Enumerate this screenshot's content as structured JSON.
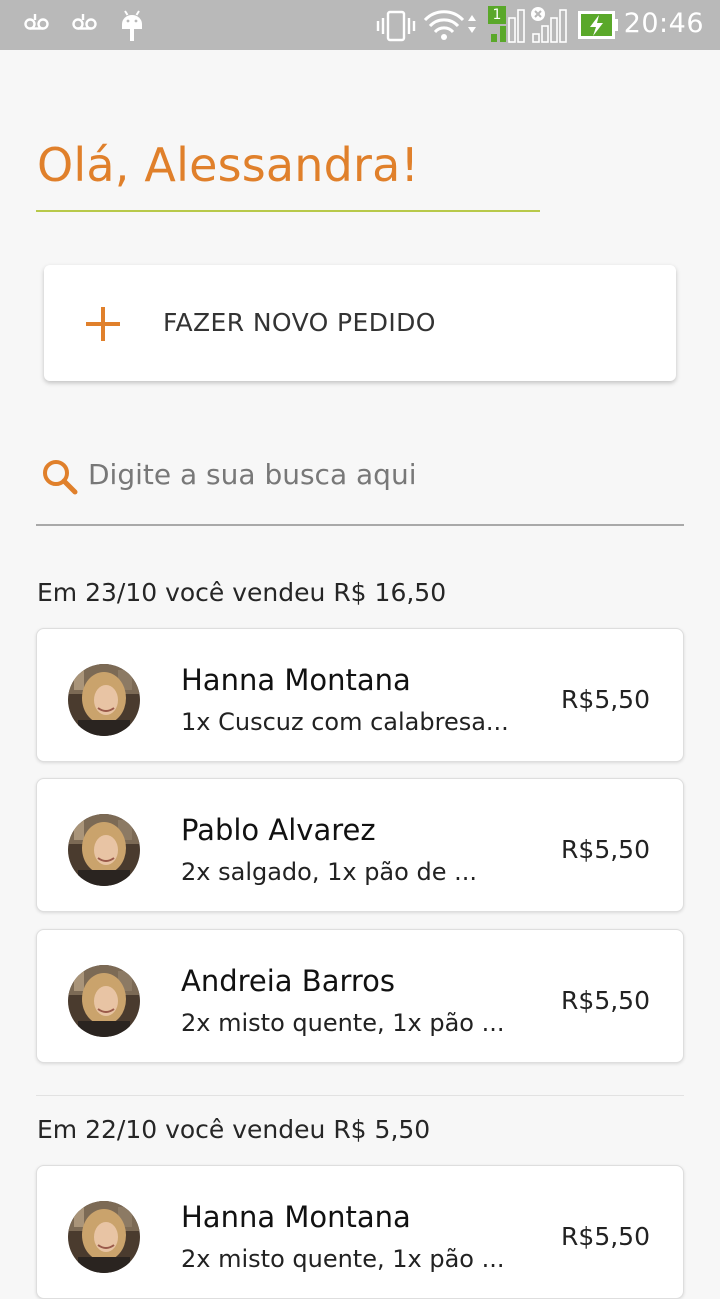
{
  "status_bar": {
    "time": "20:46",
    "icons": [
      "voicemail-icon",
      "voicemail-icon",
      "android-icon",
      "vibrate-icon",
      "wifi-icon",
      "signal-sim1-icon",
      "signal-no-service-icon",
      "battery-charging-icon"
    ],
    "sim_badge": "1"
  },
  "greeting": "Olá, Alessandra!",
  "new_order": {
    "icon": "plus-icon",
    "label": "FAZER NOVO PEDIDO"
  },
  "search": {
    "icon": "search-icon",
    "placeholder": "Digite a sua busca aqui",
    "value": ""
  },
  "colors": {
    "accent": "#e0802b",
    "underline": "#b8c94a",
    "status_bar": "#b9b9b9",
    "background": "#f7f7f7"
  },
  "sections": [
    {
      "header": "Em 23/10 você vendeu R$ 16,50",
      "orders": [
        {
          "name": "Hanna Montana",
          "items": "1x Cuscuz com calabresa...",
          "price": "R$5,50"
        },
        {
          "name": "Pablo Alvarez",
          "items": "2x salgado, 1x pão de ...",
          "price": "R$5,50"
        },
        {
          "name": "Andreia Barros",
          "items": "2x misto quente, 1x pão ...",
          "price": "R$5,50"
        }
      ]
    },
    {
      "header": "Em 22/10 você vendeu R$ 5,50",
      "orders": [
        {
          "name": "Hanna Montana",
          "items": "2x misto quente, 1x pão ...",
          "price": "R$5,50"
        }
      ]
    }
  ]
}
